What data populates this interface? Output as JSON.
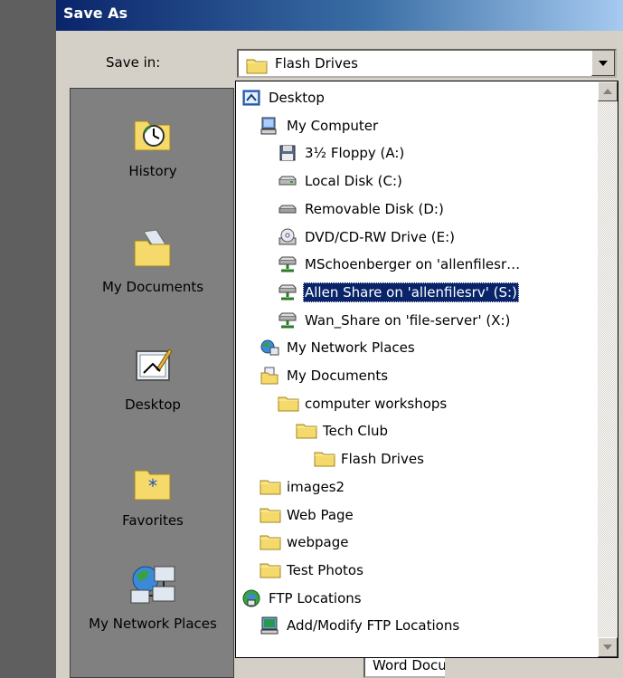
{
  "window": {
    "title": "Save As"
  },
  "save_in": {
    "label": "Save in:",
    "mnemonic_note": "i",
    "current_value": "Flash Drives",
    "current_icon": "folder-icon"
  },
  "places_bar": [
    {
      "label": "History",
      "icon": "history-icon"
    },
    {
      "label": "My Documents",
      "icon": "my-documents-icon"
    },
    {
      "label": "Desktop",
      "icon": "desktop-icon"
    },
    {
      "label": "Favorites",
      "icon": "favorites-icon"
    },
    {
      "label": "My Network Places",
      "icon": "network-places-icon"
    }
  ],
  "dropdown_items": [
    {
      "label": "Desktop",
      "icon": "desktop-icon",
      "level": 0,
      "selected": false
    },
    {
      "label": "My Computer",
      "icon": "my-computer-icon",
      "level": 1,
      "selected": false
    },
    {
      "label": "3½ Floppy (A:)",
      "icon": "floppy-icon",
      "level": 2,
      "selected": false
    },
    {
      "label": "Local Disk (C:)",
      "icon": "hard-disk-icon",
      "level": 2,
      "selected": false
    },
    {
      "label": "Removable Disk (D:)",
      "icon": "removable-disk-icon",
      "level": 2,
      "selected": false
    },
    {
      "label": "DVD/CD-RW Drive (E:)",
      "icon": "cd-drive-icon",
      "level": 2,
      "selected": false
    },
    {
      "label": "MSchoenberger on 'allenfilesr…",
      "icon": "network-drive-icon",
      "level": 2,
      "selected": false
    },
    {
      "label": "Allen Share on 'allenfilesrv' (S:)",
      "icon": "network-drive-icon",
      "level": 2,
      "selected": true
    },
    {
      "label": "Wan_Share on 'file-server' (X:)",
      "icon": "network-drive-icon",
      "level": 2,
      "selected": false
    },
    {
      "label": "My Network Places",
      "icon": "network-places-icon",
      "level": 1,
      "selected": false
    },
    {
      "label": "My Documents",
      "icon": "my-documents-icon",
      "level": 1,
      "selected": false
    },
    {
      "label": "computer workshops",
      "icon": "folder-icon",
      "level": 2,
      "selected": false
    },
    {
      "label": "Tech Club",
      "icon": "folder-icon",
      "level": 3,
      "selected": false
    },
    {
      "label": "Flash Drives",
      "icon": "folder-icon",
      "level": 4,
      "selected": false
    },
    {
      "label": "images2",
      "icon": "folder-icon",
      "level": 1,
      "selected": false
    },
    {
      "label": "Web Page",
      "icon": "folder-icon",
      "level": 1,
      "selected": false
    },
    {
      "label": "webpage",
      "icon": "folder-icon",
      "level": 1,
      "selected": false
    },
    {
      "label": "Test Photos",
      "icon": "folder-icon",
      "level": 1,
      "selected": false
    },
    {
      "label": "FTP Locations",
      "icon": "ftp-icon",
      "level": 0,
      "selected": false
    },
    {
      "label": "Add/Modify FTP Locations",
      "icon": "ftp-add-icon",
      "level": 1,
      "selected": false
    }
  ],
  "save_as_type": {
    "value": "Word Document (*.doc)"
  },
  "colors": {
    "title_start": "#0a246a",
    "title_end": "#a6caf0",
    "selection": "#0a246a",
    "dialog_bg": "#d4d0c8",
    "folder_yellow": "#f5d96b"
  }
}
